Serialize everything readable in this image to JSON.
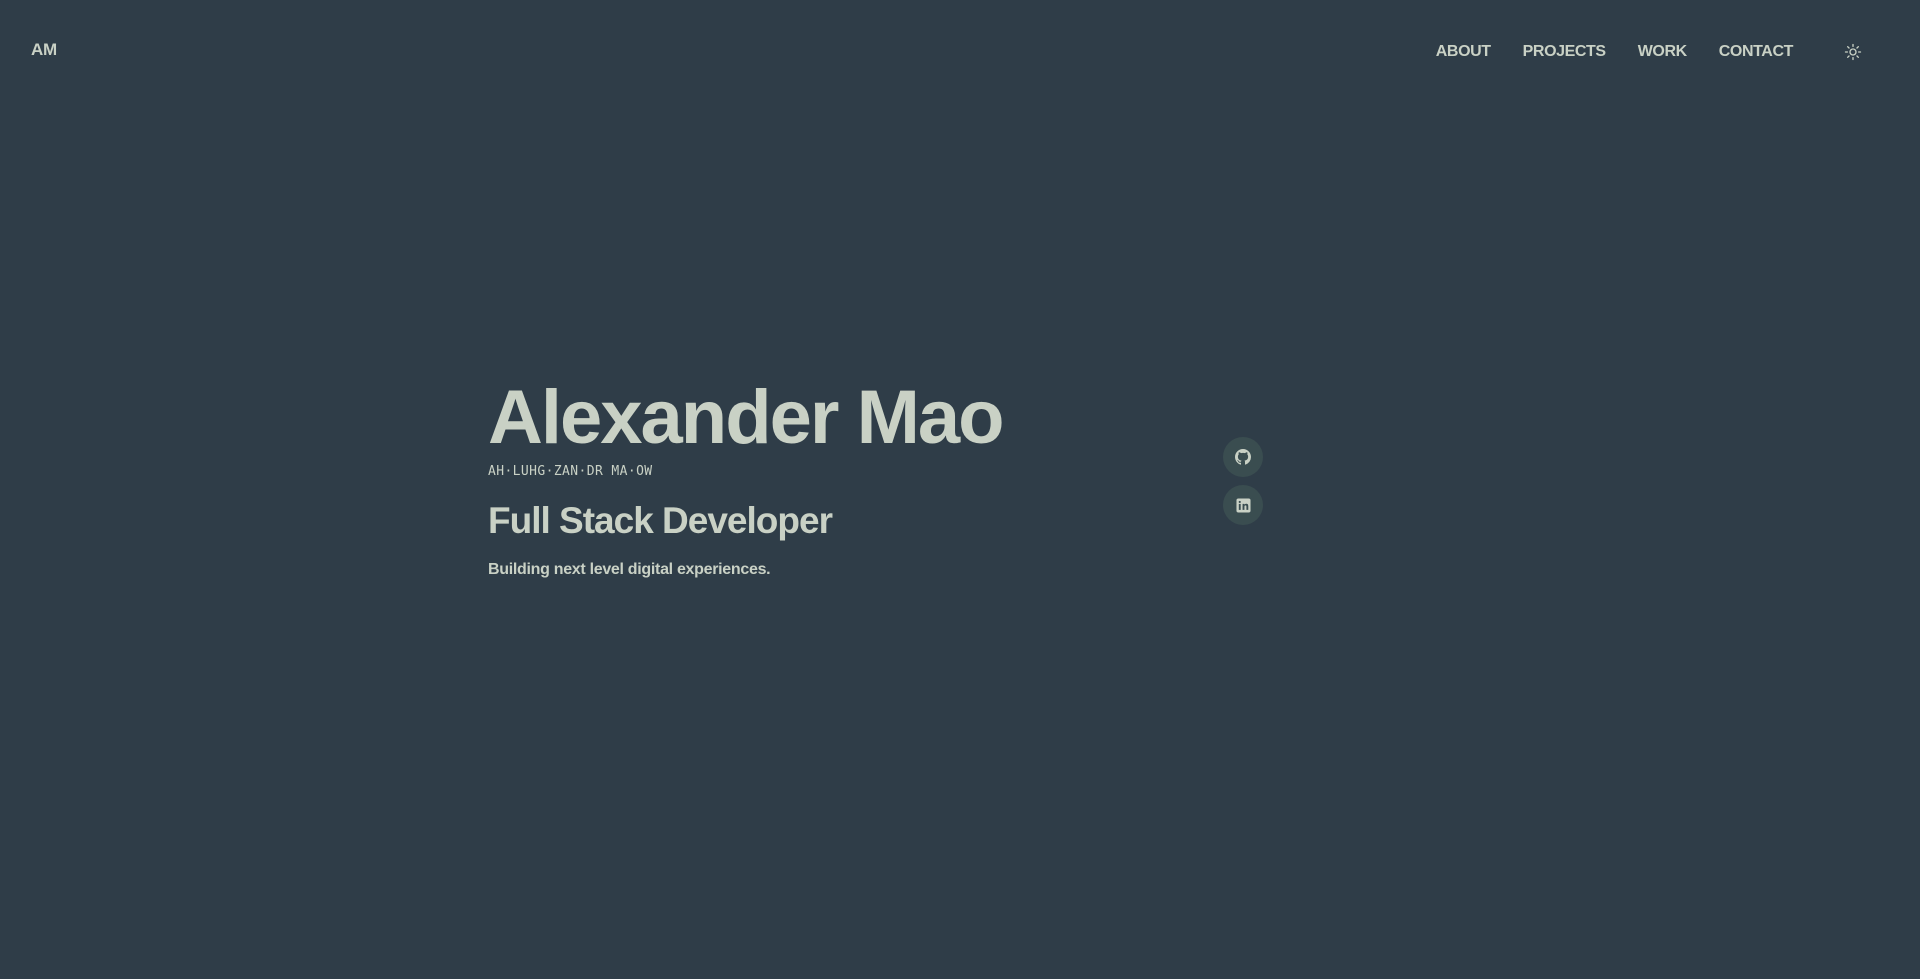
{
  "header": {
    "logo": "AM",
    "nav": [
      {
        "label": "ABOUT"
      },
      {
        "label": "PROJECTS"
      },
      {
        "label": "WORK"
      },
      {
        "label": "CONTACT"
      }
    ],
    "theme_toggle_icon": "sun-icon"
  },
  "hero": {
    "name": "Alexander Mao",
    "pronunciation": "AH·LUHG·ZAN·DR MA·OW",
    "role": "Full Stack Developer",
    "tagline": "Building next level digital experiences."
  },
  "socials": [
    {
      "icon": "github-icon"
    },
    {
      "icon": "linkedin-icon"
    }
  ],
  "colors": {
    "background": "#2f3d48",
    "text": "#c9d1c5",
    "social_button_bg": "#3a4d50"
  }
}
